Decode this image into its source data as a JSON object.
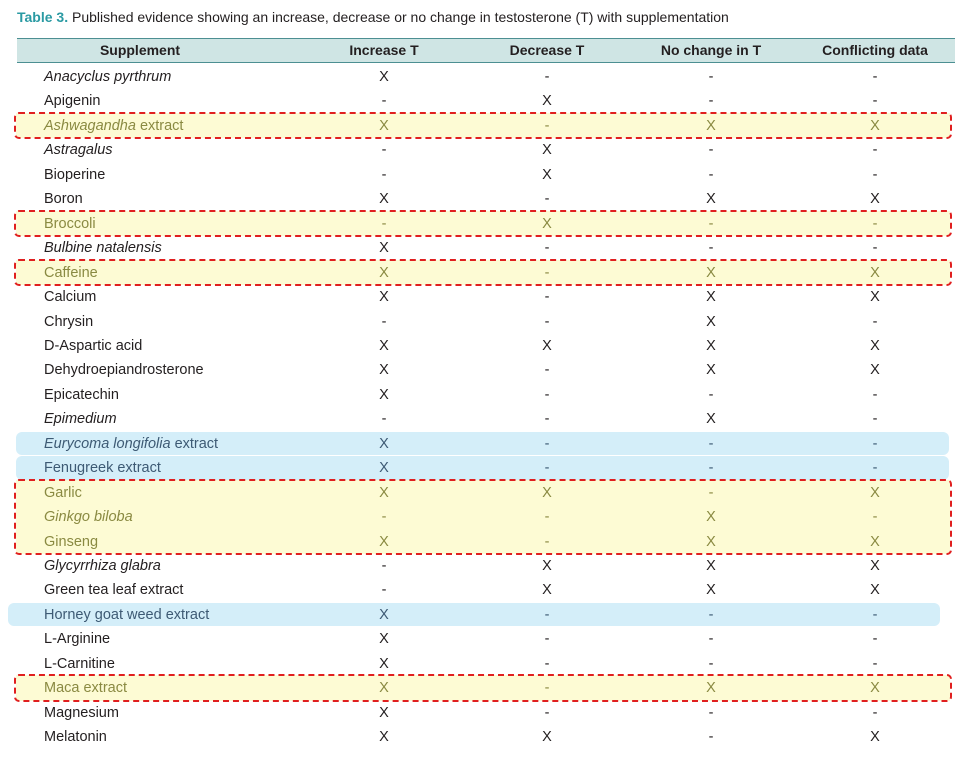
{
  "caption": {
    "label": "Table 3.",
    "text": "Published evidence showing an increase, decrease or no change in testosterone (T) with supplementation"
  },
  "columns": [
    "Supplement",
    "Increase T",
    "Decrease T",
    "No change in T",
    "Conflicting data"
  ],
  "rows": [
    {
      "name": "Anacyclus pyrthrum",
      "italic": "Anacyclus pyrthrum",
      "rest": "",
      "increase": "X",
      "decrease": "-",
      "nochange": "-",
      "conflicting": "-",
      "hl": ""
    },
    {
      "name": "Apigenin",
      "italic": "",
      "rest": "Apigenin",
      "increase": "-",
      "decrease": "X",
      "nochange": "-",
      "conflicting": "-",
      "hl": ""
    },
    {
      "name": "Ashwagandha extract",
      "italic": "Ashwagandha",
      "rest": " extract",
      "increase": "X",
      "decrease": "-",
      "nochange": "X",
      "conflicting": "X",
      "hl": "yellow"
    },
    {
      "name": "Astragalus",
      "italic": "Astragalus",
      "rest": "",
      "increase": "-",
      "decrease": "X",
      "nochange": "-",
      "conflicting": "-",
      "hl": ""
    },
    {
      "name": "Bioperine",
      "italic": "",
      "rest": "Bioperine",
      "increase": "-",
      "decrease": "X",
      "nochange": "-",
      "conflicting": "-",
      "hl": ""
    },
    {
      "name": "Boron",
      "italic": "",
      "rest": "Boron",
      "increase": "X",
      "decrease": "-",
      "nochange": "X",
      "conflicting": "X",
      "hl": ""
    },
    {
      "name": "Broccoli",
      "italic": "",
      "rest": "Broccoli",
      "increase": "-",
      "decrease": "X",
      "nochange": "-",
      "conflicting": "-",
      "hl": "yellow"
    },
    {
      "name": "Bulbine natalensis",
      "italic": "Bulbine natalensis",
      "rest": "",
      "increase": "X",
      "decrease": "-",
      "nochange": "-",
      "conflicting": "-",
      "hl": ""
    },
    {
      "name": "Caffeine",
      "italic": "",
      "rest": "Caffeine",
      "increase": "X",
      "decrease": "-",
      "nochange": "X",
      "conflicting": "X",
      "hl": "yellow"
    },
    {
      "name": "Calcium",
      "italic": "",
      "rest": "Calcium",
      "increase": "X",
      "decrease": "-",
      "nochange": "X",
      "conflicting": "X",
      "hl": ""
    },
    {
      "name": "Chrysin",
      "italic": "",
      "rest": "Chrysin",
      "increase": "-",
      "decrease": "-",
      "nochange": "X",
      "conflicting": "-",
      "hl": ""
    },
    {
      "name": "D-Aspartic acid",
      "italic": "",
      "rest": "D-Aspartic acid",
      "increase": "X",
      "decrease": "X",
      "nochange": "X",
      "conflicting": "X",
      "hl": ""
    },
    {
      "name": "Dehydroepiandrosterone",
      "italic": "",
      "rest": "Dehydroepiandrosterone",
      "increase": "X",
      "decrease": "-",
      "nochange": "X",
      "conflicting": "X",
      "hl": ""
    },
    {
      "name": "Epicatechin",
      "italic": "",
      "rest": "Epicatechin",
      "increase": "X",
      "decrease": "-",
      "nochange": "-",
      "conflicting": "-",
      "hl": ""
    },
    {
      "name": "Epimedium",
      "italic": "Epimedium",
      "rest": "",
      "increase": "-",
      "decrease": "-",
      "nochange": "X",
      "conflicting": "-",
      "hl": ""
    },
    {
      "name": "Eurycoma longifolia extract",
      "italic": "Eurycoma longifolia",
      "rest": " extract",
      "increase": "X",
      "decrease": "-",
      "nochange": "-",
      "conflicting": "-",
      "hl": "blue"
    },
    {
      "name": "Fenugreek extract",
      "italic": "",
      "rest": "Fenugreek extract",
      "increase": "X",
      "decrease": "-",
      "nochange": "-",
      "conflicting": "-",
      "hl": "blue"
    },
    {
      "name": "Garlic",
      "italic": "",
      "rest": "Garlic",
      "increase": "X",
      "decrease": "X",
      "nochange": "-",
      "conflicting": "X",
      "hl": "yellow"
    },
    {
      "name": "Ginkgo biloba",
      "italic": "Ginkgo biloba",
      "rest": "",
      "increase": "-",
      "decrease": "-",
      "nochange": "X",
      "conflicting": "-",
      "hl": "yellow"
    },
    {
      "name": "Ginseng",
      "italic": "",
      "rest": "Ginseng",
      "increase": "X",
      "decrease": "-",
      "nochange": "X",
      "conflicting": "X",
      "hl": "yellow"
    },
    {
      "name": "Glycyrrhiza glabra",
      "italic": "Glycyrrhiza glabra",
      "rest": "",
      "increase": "-",
      "decrease": "X",
      "nochange": "X",
      "conflicting": "X",
      "hl": ""
    },
    {
      "name": "Green tea leaf extract",
      "italic": "",
      "rest": "Green tea leaf extract",
      "increase": "-",
      "decrease": "X",
      "nochange": "X",
      "conflicting": "X",
      "hl": ""
    },
    {
      "name": "Horney goat weed extract",
      "italic": "",
      "rest": "Horney goat weed extract",
      "increase": "X",
      "decrease": "-",
      "nochange": "-",
      "conflicting": "-",
      "hl": "blue"
    },
    {
      "name": "L-Arginine",
      "italic": "",
      "rest": "L-Arginine",
      "increase": "X",
      "decrease": "-",
      "nochange": "-",
      "conflicting": "-",
      "hl": ""
    },
    {
      "name": "L-Carnitine",
      "italic": "",
      "rest": "L-Carnitine",
      "increase": "X",
      "decrease": "-",
      "nochange": "-",
      "conflicting": "-",
      "hl": ""
    },
    {
      "name": "Maca extract",
      "italic": "",
      "rest": "Maca extract",
      "increase": "X",
      "decrease": "-",
      "nochange": "X",
      "conflicting": "X",
      "hl": "yellow"
    },
    {
      "name": "Magnesium",
      "italic": "",
      "rest": "Magnesium",
      "increase": "X",
      "decrease": "-",
      "nochange": "-",
      "conflicting": "-",
      "hl": ""
    },
    {
      "name": "Melatonin",
      "italic": "",
      "rest": "Melatonin",
      "increase": "X",
      "decrease": "X",
      "nochange": "-",
      "conflicting": "X",
      "hl": ""
    }
  ],
  "colors": {
    "caption_accent": "#2a9aa3",
    "header_fill": "#cfe5e4",
    "highlight_yellow": "#fdfbd4",
    "highlight_blue": "#d4eef9",
    "dashed_outline": "#e01f1f"
  }
}
